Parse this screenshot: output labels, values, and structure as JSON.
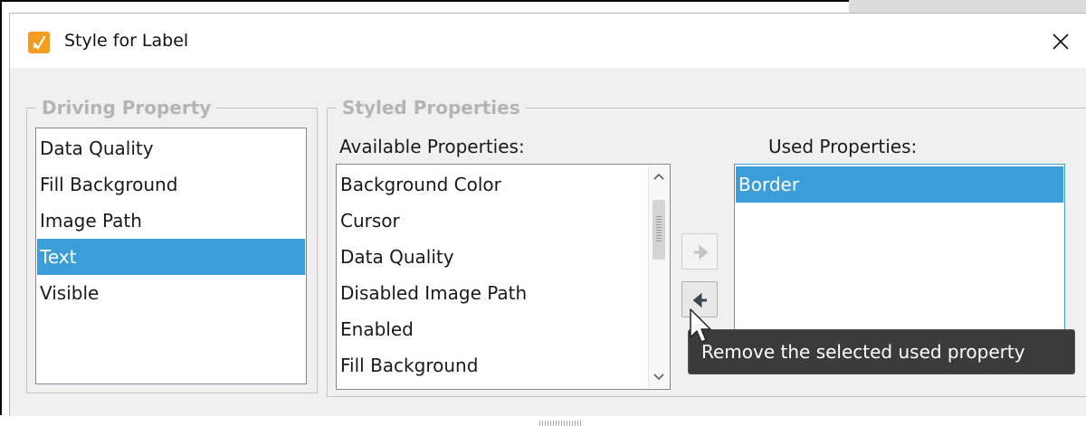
{
  "window": {
    "title": "Style for Label",
    "icon": "brush-icon",
    "close_icon": "close-icon",
    "accent": "#f39c1f"
  },
  "driving_property": {
    "legend": "Driving Property",
    "items": [
      "Data Quality",
      "Fill Background",
      "Image Path",
      "Text",
      "Visible"
    ],
    "selected": "Text"
  },
  "styled_properties": {
    "legend": "Styled Properties",
    "available_label": "Available Properties:",
    "used_label": "Used Properties:",
    "available": [
      "Background Color",
      "Cursor",
      "Data Quality",
      "Disabled Image Path",
      "Enabled",
      "Fill Background"
    ],
    "used": [
      "Border"
    ],
    "used_selected": "Border",
    "add_button_icon": "arrow-right-icon",
    "remove_button_icon": "arrow-left-icon"
  },
  "tooltip": {
    "text": "Remove the selected used property"
  },
  "colors": {
    "selection": "#3c9ddb",
    "tooltip_bg": "#3b3b3b"
  }
}
